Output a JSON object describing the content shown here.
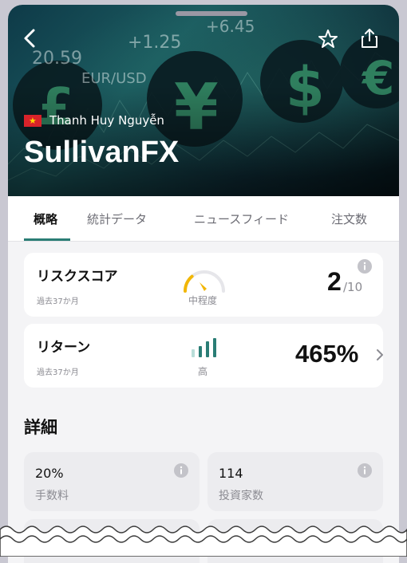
{
  "header": {
    "owner_name": "Thanh Huy Nguyễn",
    "strategy_title": "SullivanFX",
    "bg_numbers": [
      "20.59",
      "+1.25",
      "+6.45",
      "EUR/USD"
    ]
  },
  "tabs": [
    {
      "label": "概略"
    },
    {
      "label": "統計データ"
    },
    {
      "label": "ニュースフィード"
    },
    {
      "label": "注文数"
    }
  ],
  "risk": {
    "title": "リスクスコア",
    "period": "過去37か月",
    "level_label": "中程度",
    "score": "2",
    "score_max": "/10",
    "gauge_level": 0.2
  },
  "returns": {
    "title": "リターン",
    "period": "過去37か月",
    "level_label": "高",
    "value": "465%"
  },
  "details": {
    "section_title": "詳細",
    "items": [
      {
        "value": "20%",
        "label": "手数料"
      },
      {
        "value": "114",
        "label": "投資家数"
      }
    ]
  },
  "colors": {
    "accent": "#2a7d75",
    "gauge_active": "#f2b705",
    "flag_red": "#d8232a"
  }
}
